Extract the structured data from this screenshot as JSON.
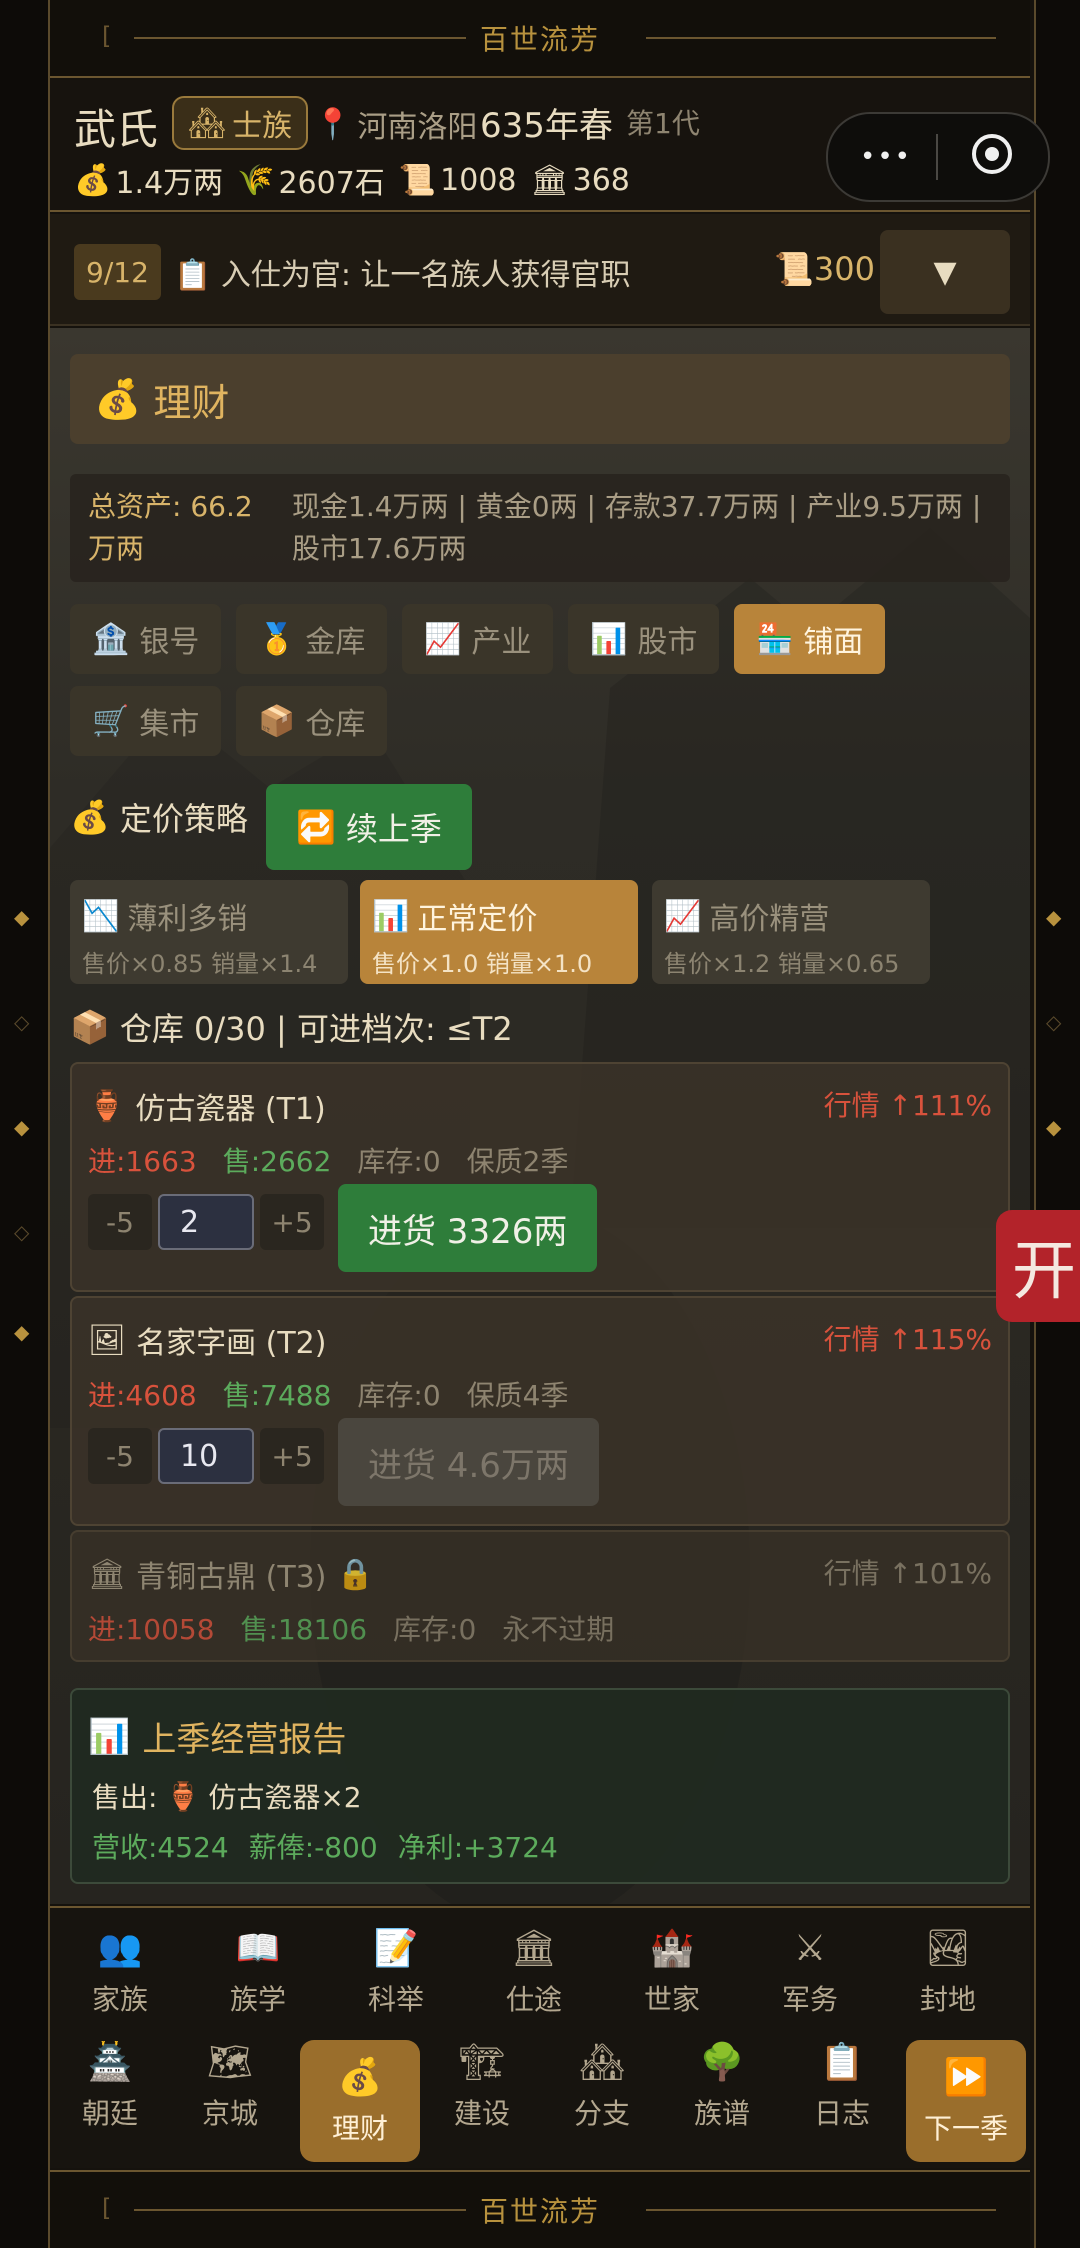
{
  "banner": {
    "title": "百世流芳"
  },
  "header": {
    "clan_name": "武氏",
    "rank": "士族",
    "location": "河南洛阳",
    "year": "635年春",
    "generation": "第1代",
    "resources": [
      {
        "icon": "money-bag-icon",
        "value": "1.4万两"
      },
      {
        "icon": "grain-icon",
        "value": "2607石"
      },
      {
        "icon": "scroll-icon",
        "value": "1008"
      },
      {
        "icon": "bank-icon",
        "value": "368"
      }
    ]
  },
  "miniprogram": {
    "menu": "•••"
  },
  "quest": {
    "progress": "9/12",
    "text": "入仕为官: 让一名族人获得官职",
    "reward": "300",
    "toggle": "▼"
  },
  "section": {
    "title": "理财"
  },
  "assets": {
    "label": "总资产: 66.2万两",
    "details": "现金1.4万两 | 黄金0两 | 存款37.7万两 | 产业9.5万两 | 股市17.6万两"
  },
  "tabs": [
    {
      "label": "银号",
      "icon": "bank-icon",
      "active": false
    },
    {
      "label": "金库",
      "icon": "medal-icon",
      "active": false
    },
    {
      "label": "产业",
      "icon": "chart-up-icon",
      "active": false
    },
    {
      "label": "股市",
      "icon": "bar-chart-icon",
      "active": false
    },
    {
      "label": "铺面",
      "icon": "store-icon",
      "active": true
    },
    {
      "label": "集市",
      "icon": "cart-icon",
      "active": false
    },
    {
      "label": "仓库",
      "icon": "box-icon",
      "active": false
    }
  ],
  "pricing": {
    "title": "定价策略",
    "renew_label": "续上季",
    "strategies": [
      {
        "name": "薄利多销",
        "sub": "售价×0.85 销量×1.4",
        "active": false
      },
      {
        "name": "正常定价",
        "sub": "售价×1.0 销量×1.0",
        "active": true
      },
      {
        "name": "高价精营",
        "sub": "售价×1.2 销量×0.65",
        "active": false
      }
    ]
  },
  "warehouse": {
    "title": "仓库 0/30  |  可进档次: ≤T2"
  },
  "items": [
    {
      "name": "仿古瓷器 (T1)",
      "market": "行情 ↑111%",
      "buy": "进:1663",
      "sell": "售:2662",
      "stock": "库存:0",
      "shelf": "保质2季",
      "minus": "-5",
      "qty": "2",
      "plus": "+5",
      "purchase": "进货 3326两"
    },
    {
      "name": "名家字画 (T2)",
      "market": "行情 ↑115%",
      "buy": "进:4608",
      "sell": "售:7488",
      "stock": "库存:0",
      "shelf": "保质4季",
      "minus": "-5",
      "qty": "10",
      "plus": "+5",
      "purchase": "进货 4.6万两"
    },
    {
      "name": "青铜古鼎 (T3)",
      "market": "行情 ↑101%",
      "buy": "进:10058",
      "sell": "售:18106",
      "stock": "库存:0",
      "shelf": "永不过期"
    }
  ],
  "report": {
    "title": "上季经营报告",
    "sold_label": "售出:",
    "sold_item": "仿古瓷器×2",
    "revenue": "营收:4524",
    "salary": "薪俸:-800",
    "profit": "净利:+3724"
  },
  "side_tab": "开",
  "nav_row1": [
    {
      "label": "家族",
      "icon": "family-icon"
    },
    {
      "label": "族学",
      "icon": "book-icon"
    },
    {
      "label": "科举",
      "icon": "memo-icon"
    },
    {
      "label": "仕途",
      "icon": "bank-icon"
    },
    {
      "label": "世家",
      "icon": "castle-icon"
    },
    {
      "label": "军务",
      "icon": "swords-icon"
    },
    {
      "label": "封地",
      "icon": "landscape-icon"
    }
  ],
  "nav_row2": [
    {
      "label": "朝廷",
      "icon": "palace-icon"
    },
    {
      "label": "京城",
      "icon": "map-icon"
    },
    {
      "label": "理财",
      "icon": "money-bag-icon",
      "active": true
    },
    {
      "label": "建设",
      "icon": "crane-icon"
    },
    {
      "label": "分支",
      "icon": "houses-icon"
    },
    {
      "label": "族谱",
      "icon": "tree-icon"
    },
    {
      "label": "日志",
      "icon": "clipboard-icon"
    },
    {
      "label": "下一季",
      "icon": "fast-forward-icon",
      "active": true
    }
  ],
  "colors": {
    "accent": "#b8843a",
    "green": "#2e7d3a",
    "red": "#d8523c",
    "gold": "#d8b46a"
  }
}
